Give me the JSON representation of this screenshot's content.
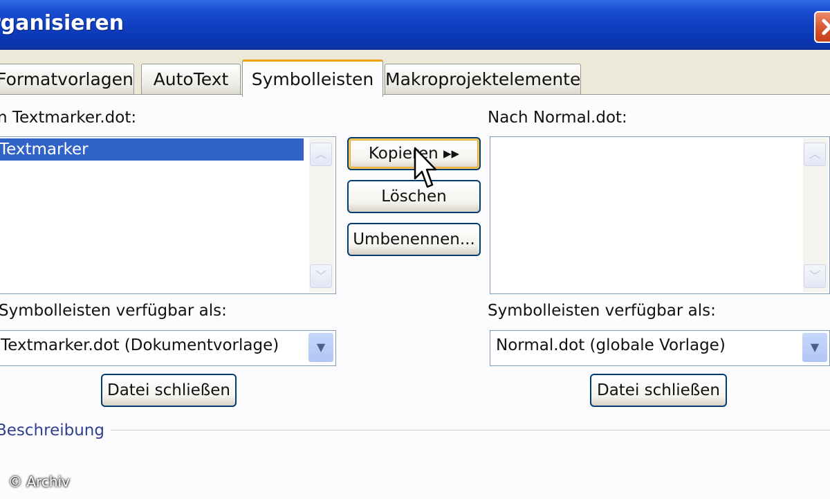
{
  "window": {
    "title": "rganisieren"
  },
  "tabs": [
    "Formatvorlagen",
    "AutoText",
    "Symbolleisten",
    "Makroprojektelemente"
  ],
  "left": {
    "source_label": "n Textmarker.dot:",
    "items": [
      "Textmarker"
    ],
    "available_label": "Symbolleisten verfügbar als:",
    "available_value": "Textmarker.dot (Dokumentvorlage)",
    "close_file": "Datei schließen"
  },
  "center": {
    "copy": "Kopieren ▸▸",
    "delete": "Löschen",
    "rename": "Umbenennen..."
  },
  "right": {
    "target_label": "Nach Normal.dot:",
    "available_label": "Symbolleisten verfügbar als:",
    "available_value": "Normal.dot (globale Vorlage)",
    "close_file": "Datei schließen"
  },
  "description_label": "Beschreibung",
  "copyright": "© Archiv",
  "icons": {
    "close": "close-icon",
    "scroll_up": "chevron-up-icon",
    "scroll_down": "chevron-down-icon",
    "dropdown": "chevron-down-icon",
    "cursor": "mouse-pointer-icon"
  },
  "colors": {
    "titlebar": "#0f3fc0",
    "selection": "#3163c6",
    "active_tab": "#f0a010",
    "close_button": "#d4512a"
  }
}
